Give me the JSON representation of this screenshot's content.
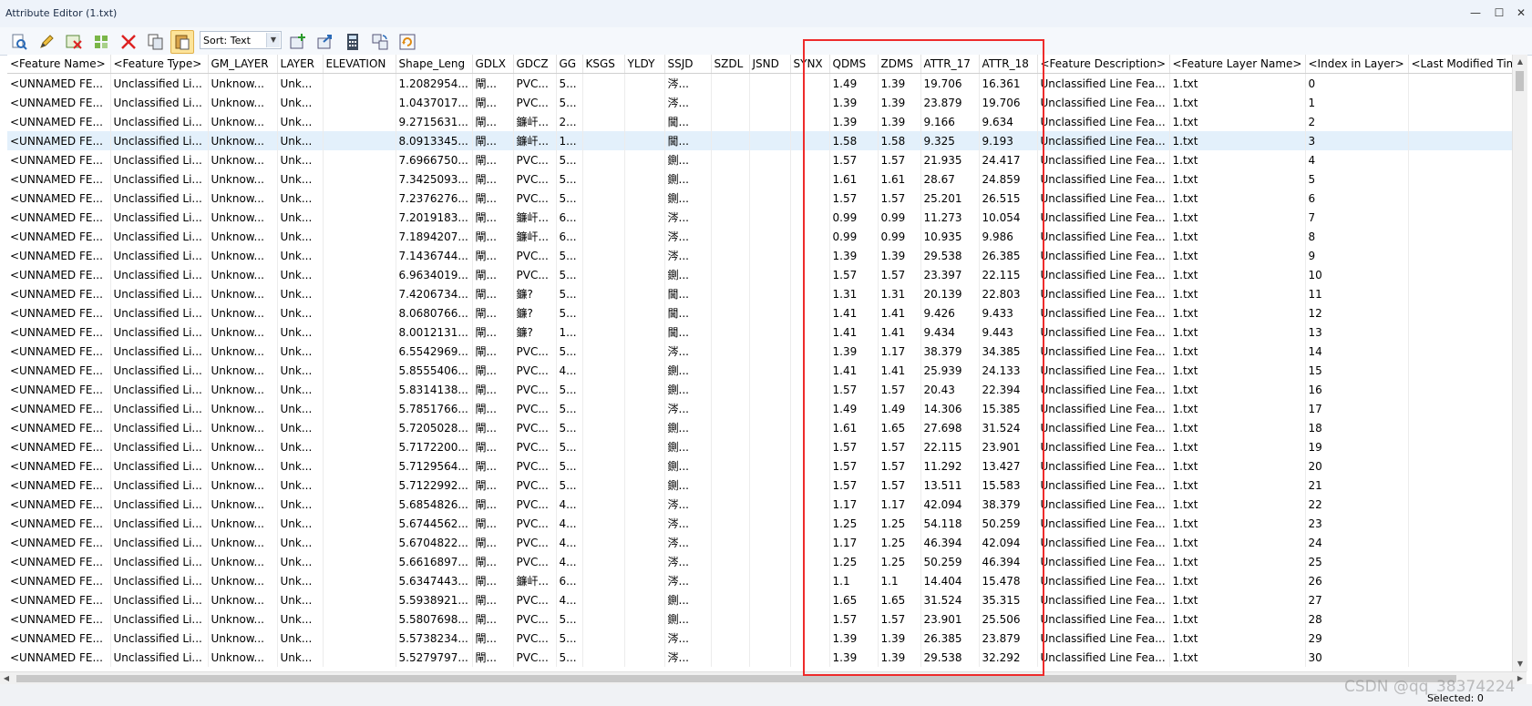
{
  "window": {
    "title": "Attribute Editor (1.txt)",
    "minimize": "—",
    "maximize": "☐",
    "close": "✕"
  },
  "toolbar": {
    "sort_label": "Sort: Text",
    "icons": [
      "find-features-icon",
      "edit-pencil-icon",
      "delete-attribute-icon",
      "select-features-icon",
      "delete-features-icon",
      "copy-icon",
      "paste-icon",
      "add-attribute-icon",
      "export-icon",
      "calculator-icon",
      "swap-icon",
      "refresh-icon"
    ],
    "accent": "#fde49a"
  },
  "columns": [
    "<Feature Name>",
    "<Feature Type>",
    "GM_LAYER",
    "LAYER",
    "ELEVATION",
    "Shape_Leng",
    "GDLX",
    "GDCZ",
    "GG",
    "KSGS",
    "YLDY",
    "SSJD",
    "SZDL",
    "JSND",
    "SYNX",
    "QDMS",
    "ZDMS",
    "ATTR_17",
    "ATTR_18",
    "<Feature Description>",
    "<Feature Layer Name>",
    "<Index in Layer>",
    "<Last Modified Time>"
  ],
  "rows": [
    [
      "<UNNAMED FE...",
      "Unclassified Li...",
      "Unknow...",
      "Unk...",
      "",
      "1.2082954...",
      "閘...",
      "PVC...",
      "5...",
      "",
      "",
      "涔...",
      "",
      "",
      "",
      "1.49",
      "1.39",
      "19.706",
      "16.361",
      "Unclassified Line Fea...",
      "1.txt",
      "0",
      ""
    ],
    [
      "<UNNAMED FE...",
      "Unclassified Li...",
      "Unknow...",
      "Unk...",
      "",
      "1.0437017...",
      "閘...",
      "PVC...",
      "5...",
      "",
      "",
      "涔...",
      "",
      "",
      "",
      "1.39",
      "1.39",
      "23.879",
      "19.706",
      "Unclassified Line Fea...",
      "1.txt",
      "1",
      ""
    ],
    [
      "<UNNAMED FE...",
      "Unclassified Li...",
      "Unknow...",
      "Unk...",
      "",
      "9.2715631...",
      "閘...",
      "鐮屽...",
      "2...",
      "",
      "",
      "閫...",
      "",
      "",
      "",
      "1.39",
      "1.39",
      "9.166",
      "9.634",
      "Unclassified Line Fea...",
      "1.txt",
      "2",
      ""
    ],
    [
      "<UNNAMED FE...",
      "Unclassified Li...",
      "Unknow...",
      "Unk...",
      "",
      "8.0913345...",
      "閘...",
      "鐮屽...",
      "1...",
      "",
      "",
      "閫...",
      "",
      "",
      "",
      "1.58",
      "1.58",
      "9.325",
      "9.193",
      "Unclassified Line Fea...",
      "1.txt",
      "3",
      ""
    ],
    [
      "<UNNAMED FE...",
      "Unclassified Li...",
      "Unknow...",
      "Unk...",
      "",
      "7.6966750...",
      "閘...",
      "PVC...",
      "5...",
      "",
      "",
      "鍘...",
      "",
      "",
      "",
      "1.57",
      "1.57",
      "21.935",
      "24.417",
      "Unclassified Line Fea...",
      "1.txt",
      "4",
      ""
    ],
    [
      "<UNNAMED FE...",
      "Unclassified Li...",
      "Unknow...",
      "Unk...",
      "",
      "7.3425093...",
      "閘...",
      "PVC...",
      "5...",
      "",
      "",
      "鍘...",
      "",
      "",
      "",
      "1.61",
      "1.61",
      "28.67",
      "24.859",
      "Unclassified Line Fea...",
      "1.txt",
      "5",
      ""
    ],
    [
      "<UNNAMED FE...",
      "Unclassified Li...",
      "Unknow...",
      "Unk...",
      "",
      "7.2376276...",
      "閘...",
      "PVC...",
      "5...",
      "",
      "",
      "鍘...",
      "",
      "",
      "",
      "1.57",
      "1.57",
      "25.201",
      "26.515",
      "Unclassified Line Fea...",
      "1.txt",
      "6",
      ""
    ],
    [
      "<UNNAMED FE...",
      "Unclassified Li...",
      "Unknow...",
      "Unk...",
      "",
      "7.2019183...",
      "閘...",
      "鐮屽...",
      "6...",
      "",
      "",
      "涔...",
      "",
      "",
      "",
      "0.99",
      "0.99",
      "11.273",
      "10.054",
      "Unclassified Line Fea...",
      "1.txt",
      "7",
      ""
    ],
    [
      "<UNNAMED FE...",
      "Unclassified Li...",
      "Unknow...",
      "Unk...",
      "",
      "7.1894207...",
      "閘...",
      "鐮屽...",
      "6...",
      "",
      "",
      "涔...",
      "",
      "",
      "",
      "0.99",
      "0.99",
      "10.935",
      "9.986",
      "Unclassified Line Fea...",
      "1.txt",
      "8",
      ""
    ],
    [
      "<UNNAMED FE...",
      "Unclassified Li...",
      "Unknow...",
      "Unk...",
      "",
      "7.1436744...",
      "閘...",
      "PVC...",
      "5...",
      "",
      "",
      "涔...",
      "",
      "",
      "",
      "1.39",
      "1.39",
      "29.538",
      "26.385",
      "Unclassified Line Fea...",
      "1.txt",
      "9",
      ""
    ],
    [
      "<UNNAMED FE...",
      "Unclassified Li...",
      "Unknow...",
      "Unk...",
      "",
      "6.9634019...",
      "閘...",
      "PVC...",
      "5...",
      "",
      "",
      "鍘...",
      "",
      "",
      "",
      "1.57",
      "1.57",
      "23.397",
      "22.115",
      "Unclassified Line Fea...",
      "1.txt",
      "10",
      ""
    ],
    [
      "<UNNAMED FE...",
      "Unclassified Li...",
      "Unknow...",
      "Unk...",
      "",
      "7.4206734...",
      "閘...",
      "鐮?",
      "5...",
      "",
      "",
      "閫...",
      "",
      "",
      "",
      "1.31",
      "1.31",
      "20.139",
      "22.803",
      "Unclassified Line Fea...",
      "1.txt",
      "11",
      ""
    ],
    [
      "<UNNAMED FE...",
      "Unclassified Li...",
      "Unknow...",
      "Unk...",
      "",
      "8.0680766...",
      "閘...",
      "鐮?",
      "5...",
      "",
      "",
      "閫...",
      "",
      "",
      "",
      "1.41",
      "1.41",
      "9.426",
      "9.433",
      "Unclassified Line Fea...",
      "1.txt",
      "12",
      ""
    ],
    [
      "<UNNAMED FE...",
      "Unclassified Li...",
      "Unknow...",
      "Unk...",
      "",
      "8.0012131...",
      "閘...",
      "鐮?",
      "1...",
      "",
      "",
      "閫...",
      "",
      "",
      "",
      "1.41",
      "1.41",
      "9.434",
      "9.443",
      "Unclassified Line Fea...",
      "1.txt",
      "13",
      ""
    ],
    [
      "<UNNAMED FE...",
      "Unclassified Li...",
      "Unknow...",
      "Unk...",
      "",
      "6.5542969...",
      "閘...",
      "PVC...",
      "5...",
      "",
      "",
      "涔...",
      "",
      "",
      "",
      "1.39",
      "1.17",
      "38.379",
      "34.385",
      "Unclassified Line Fea...",
      "1.txt",
      "14",
      ""
    ],
    [
      "<UNNAMED FE...",
      "Unclassified Li...",
      "Unknow...",
      "Unk...",
      "",
      "5.8555406...",
      "閘...",
      "PVC...",
      "4...",
      "",
      "",
      "鍘...",
      "",
      "",
      "",
      "1.41",
      "1.41",
      "25.939",
      "24.133",
      "Unclassified Line Fea...",
      "1.txt",
      "15",
      ""
    ],
    [
      "<UNNAMED FE...",
      "Unclassified Li...",
      "Unknow...",
      "Unk...",
      "",
      "5.8314138...",
      "閘...",
      "PVC...",
      "5...",
      "",
      "",
      "鍘...",
      "",
      "",
      "",
      "1.57",
      "1.57",
      "20.43",
      "22.394",
      "Unclassified Line Fea...",
      "1.txt",
      "16",
      ""
    ],
    [
      "<UNNAMED FE...",
      "Unclassified Li...",
      "Unknow...",
      "Unk...",
      "",
      "5.7851766...",
      "閘...",
      "PVC...",
      "5...",
      "",
      "",
      "涔...",
      "",
      "",
      "",
      "1.49",
      "1.49",
      "14.306",
      "15.385",
      "Unclassified Line Fea...",
      "1.txt",
      "17",
      ""
    ],
    [
      "<UNNAMED FE...",
      "Unclassified Li...",
      "Unknow...",
      "Unk...",
      "",
      "5.7205028...",
      "閘...",
      "PVC...",
      "5...",
      "",
      "",
      "鍘...",
      "",
      "",
      "",
      "1.61",
      "1.65",
      "27.698",
      "31.524",
      "Unclassified Line Fea...",
      "1.txt",
      "18",
      ""
    ],
    [
      "<UNNAMED FE...",
      "Unclassified Li...",
      "Unknow...",
      "Unk...",
      "",
      "5.7172200...",
      "閘...",
      "PVC...",
      "5...",
      "",
      "",
      "鍘...",
      "",
      "",
      "",
      "1.57",
      "1.57",
      "22.115",
      "23.901",
      "Unclassified Line Fea...",
      "1.txt",
      "19",
      ""
    ],
    [
      "<UNNAMED FE...",
      "Unclassified Li...",
      "Unknow...",
      "Unk...",
      "",
      "5.7129564...",
      "閘...",
      "PVC...",
      "5...",
      "",
      "",
      "鍘...",
      "",
      "",
      "",
      "1.57",
      "1.57",
      "11.292",
      "13.427",
      "Unclassified Line Fea...",
      "1.txt",
      "20",
      ""
    ],
    [
      "<UNNAMED FE...",
      "Unclassified Li...",
      "Unknow...",
      "Unk...",
      "",
      "5.7122992...",
      "閘...",
      "PVC...",
      "5...",
      "",
      "",
      "鍘...",
      "",
      "",
      "",
      "1.57",
      "1.57",
      "13.511",
      "15.583",
      "Unclassified Line Fea...",
      "1.txt",
      "21",
      ""
    ],
    [
      "<UNNAMED FE...",
      "Unclassified Li...",
      "Unknow...",
      "Unk...",
      "",
      "5.6854826...",
      "閘...",
      "PVC...",
      "4...",
      "",
      "",
      "涔...",
      "",
      "",
      "",
      "1.17",
      "1.17",
      "42.094",
      "38.379",
      "Unclassified Line Fea...",
      "1.txt",
      "22",
      ""
    ],
    [
      "<UNNAMED FE...",
      "Unclassified Li...",
      "Unknow...",
      "Unk...",
      "",
      "5.6744562...",
      "閘...",
      "PVC...",
      "4...",
      "",
      "",
      "涔...",
      "",
      "",
      "",
      "1.25",
      "1.25",
      "54.118",
      "50.259",
      "Unclassified Line Fea...",
      "1.txt",
      "23",
      ""
    ],
    [
      "<UNNAMED FE...",
      "Unclassified Li...",
      "Unknow...",
      "Unk...",
      "",
      "5.6704822...",
      "閘...",
      "PVC...",
      "4...",
      "",
      "",
      "涔...",
      "",
      "",
      "",
      "1.17",
      "1.25",
      "46.394",
      "42.094",
      "Unclassified Line Fea...",
      "1.txt",
      "24",
      ""
    ],
    [
      "<UNNAMED FE...",
      "Unclassified Li...",
      "Unknow...",
      "Unk...",
      "",
      "5.6616897...",
      "閘...",
      "PVC...",
      "4...",
      "",
      "",
      "涔...",
      "",
      "",
      "",
      "1.25",
      "1.25",
      "50.259",
      "46.394",
      "Unclassified Line Fea...",
      "1.txt",
      "25",
      ""
    ],
    [
      "<UNNAMED FE...",
      "Unclassified Li...",
      "Unknow...",
      "Unk...",
      "",
      "5.6347443...",
      "閘...",
      "鐮屽...",
      "6...",
      "",
      "",
      "涔...",
      "",
      "",
      "",
      "1.1",
      "1.1",
      "14.404",
      "15.478",
      "Unclassified Line Fea...",
      "1.txt",
      "26",
      ""
    ],
    [
      "<UNNAMED FE...",
      "Unclassified Li...",
      "Unknow...",
      "Unk...",
      "",
      "5.5938921...",
      "閘...",
      "PVC...",
      "4...",
      "",
      "",
      "鍘...",
      "",
      "",
      "",
      "1.65",
      "1.65",
      "31.524",
      "35.315",
      "Unclassified Line Fea...",
      "1.txt",
      "27",
      ""
    ],
    [
      "<UNNAMED FE...",
      "Unclassified Li...",
      "Unknow...",
      "Unk...",
      "",
      "5.5807698...",
      "閘...",
      "PVC...",
      "5...",
      "",
      "",
      "鍘...",
      "",
      "",
      "",
      "1.57",
      "1.57",
      "23.901",
      "25.506",
      "Unclassified Line Fea...",
      "1.txt",
      "28",
      ""
    ],
    [
      "<UNNAMED FE...",
      "Unclassified Li...",
      "Unknow...",
      "Unk...",
      "",
      "5.5738234...",
      "閘...",
      "PVC...",
      "5...",
      "",
      "",
      "涔...",
      "",
      "",
      "",
      "1.39",
      "1.39",
      "26.385",
      "23.879",
      "Unclassified Line Fea...",
      "1.txt",
      "29",
      ""
    ],
    [
      "<UNNAMED FE...",
      "Unclassified Li...",
      "Unknow...",
      "Unk...",
      "",
      "5.5279797...",
      "閘...",
      "PVC...",
      "5...",
      "",
      "",
      "涔...",
      "",
      "",
      "",
      "1.39",
      "1.39",
      "29.538",
      "32.292",
      "Unclassified Line Fea...",
      "1.txt",
      "30",
      ""
    ]
  ],
  "selected_row_index": 3,
  "status": {
    "selected": "Selected: 0"
  },
  "watermark": "CSDN @qq_38374224",
  "colors": {
    "selection": "#e3f0fb",
    "highlight_border": "#ee2b2b",
    "toolbar_active": "#fde49a"
  }
}
